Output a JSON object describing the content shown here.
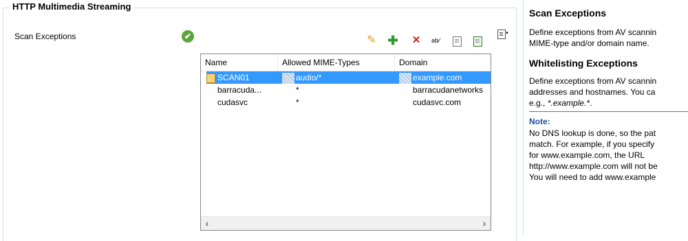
{
  "group": {
    "title": "HTTP Multimedia Streaming"
  },
  "field": {
    "label": "Scan Exceptions",
    "status": "✔"
  },
  "toolbar": {
    "edit": "✎",
    "add": "✚",
    "delete": "✕",
    "rename": "ab⁄",
    "more": "▾"
  },
  "table": {
    "columns": [
      "Name",
      "Allowed MIME-Types",
      "Domain"
    ],
    "rows": [
      {
        "name": "SCAN01",
        "mime": "audio/*",
        "domain": "example.com",
        "selected": true
      },
      {
        "name": "barracuda...",
        "mime": "*",
        "domain": "barracudanetworks",
        "selected": false
      },
      {
        "name": "cudasvc",
        "mime": "*",
        "domain": "cudasvc.com",
        "selected": false
      }
    ],
    "scroll_left": "‹",
    "scroll_right": "›"
  },
  "help": {
    "scan_title": "Scan Exceptions",
    "scan_line1": "Define exceptions from AV scannin",
    "scan_line2": "MIME-type and/or domain name.",
    "white_title": "Whitelisting Exceptions",
    "white_line1": "Define exceptions from AV scannin",
    "white_line2": "addresses and hostnames. You ca",
    "white_line3_prefix": "e.g., ",
    "white_line3_example": "*.example.*",
    "white_line3_suffix": ".",
    "note_title": "Note:",
    "note_lines": [
      "No DNS lookup is done, so the pat",
      "match. For example, if you specify",
      "for www.example.com, the URL",
      "http://www.example.com will not be",
      "You will need to add www.example"
    ]
  },
  "colors": {
    "selection": "#3399ff",
    "note": "#1b4f9b",
    "separator": "#3a7bd5"
  }
}
